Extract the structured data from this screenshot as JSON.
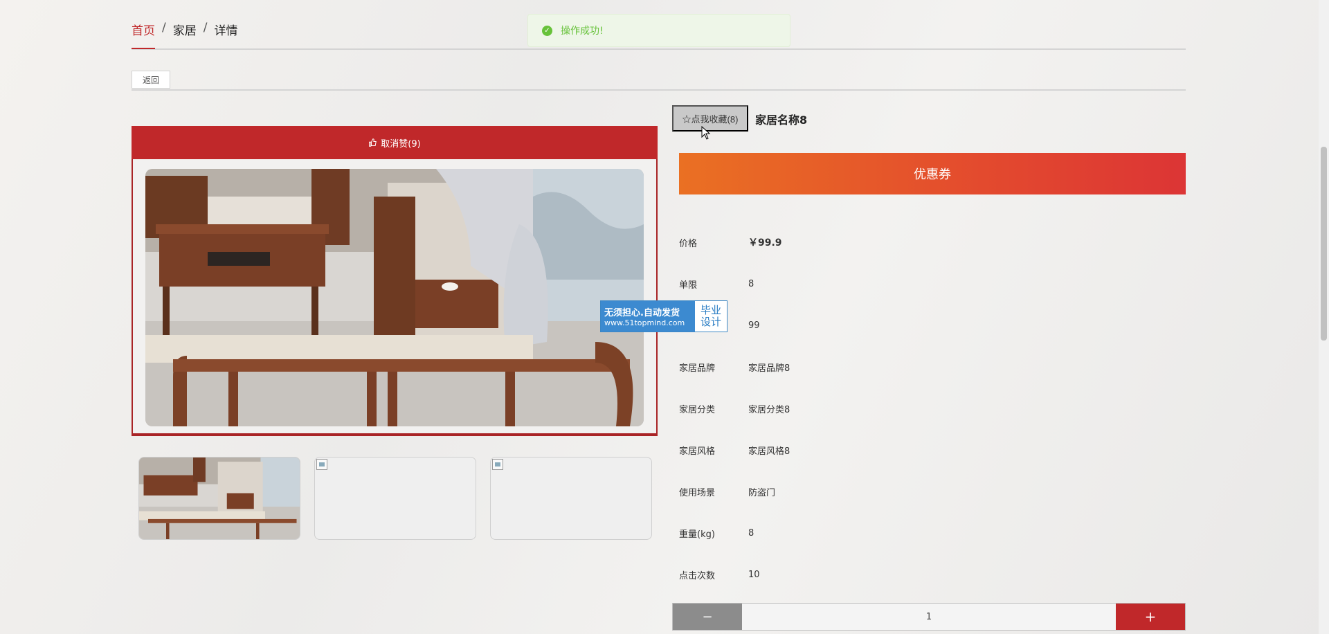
{
  "breadcrumb": {
    "home": "首页",
    "sep": "/",
    "category": "家居",
    "current": "详情"
  },
  "toast": {
    "message": "操作成功!",
    "icon": "check-circle-icon"
  },
  "back_label": "返回",
  "like_label": "取消赞(9)",
  "favorite_label": "☆点我收藏(8)",
  "product_title": "家居名称8",
  "coupon_label": "优惠券",
  "info": [
    {
      "label": "价格",
      "value": "￥99.9"
    },
    {
      "label": "单限",
      "value": "8"
    },
    {
      "label": "",
      "value": "99"
    },
    {
      "label": "家居品牌",
      "value": "家居品牌8"
    },
    {
      "label": "家居分类",
      "value": "家居分类8"
    },
    {
      "label": "家居风格",
      "value": "家居风格8"
    },
    {
      "label": "使用场景",
      "value": "防盗门"
    },
    {
      "label": "重量(kg)",
      "value": "8"
    },
    {
      "label": "点击次数",
      "value": "10"
    }
  ],
  "quantity": {
    "minus": "−",
    "value": "1",
    "plus": "+"
  },
  "watermark": {
    "line1": "无须担心.自动发货",
    "line2": "www.51topmind.com",
    "badge_line1": "毕业",
    "badge_line2": "设计"
  },
  "colors": {
    "accent": "#c0282a",
    "coupon_start": "#ea7023",
    "coupon_end": "#dc3535",
    "toast_text": "#67c23a"
  }
}
